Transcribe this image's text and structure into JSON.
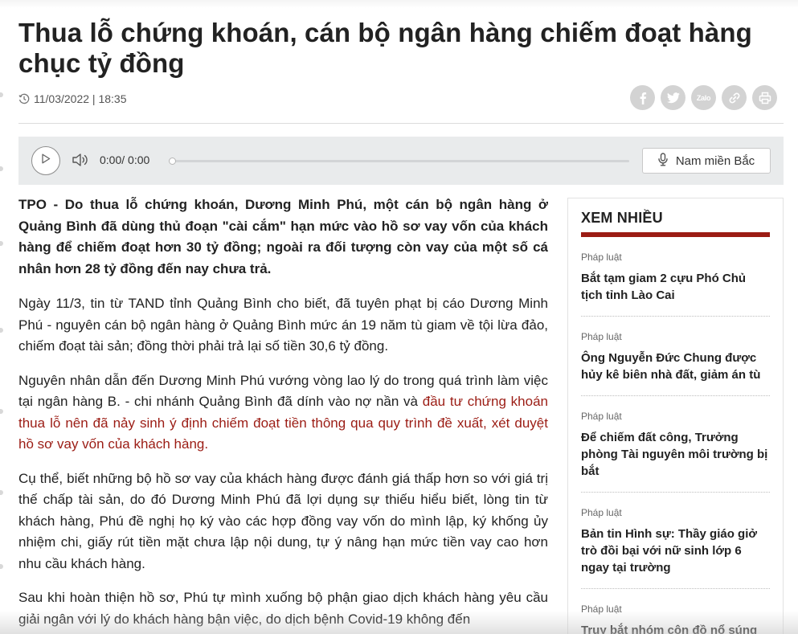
{
  "article": {
    "title": "Thua lỗ chứng khoán, cán bộ ngân hàng chiếm đoạt hàng chục tỷ đồng",
    "datetime": "11/03/2022 | 18:35",
    "sapo": "TPO - Do thua lỗ chứng khoán, Dương Minh Phú, một cán bộ ngân hàng ở Quảng Bình đã dùng thủ đoạn \"cài cắm\" hạn mức vào hồ sơ vay vốn của khách hàng để chiếm đoạt hơn 30 tỷ đồng; ngoài ra đối tượng còn vay của một số cá nhân hơn 28 tỷ đồng đến nay chưa trả.",
    "p1": "Ngày 11/3, tin từ TAND tỉnh Quảng Bình cho biết, đã tuyên phạt bị cáo Dương Minh Phú - nguyên cán bộ ngân hàng ở Quảng Bình mức án 19 năm tù giam về tội lừa đảo, chiếm đoạt tài sản; đồng thời phải trả lại số tiền 30,6 tỷ đồng.",
    "p2_text": "Nguyên nhân dẫn đến Dương Minh Phú vướng vòng lao lý do trong quá trình làm việc tại ngân hàng B. - chi nhánh Quảng Bình đã dính vào nợ nần và ",
    "p2_link": "đầu tư chứng khoán thua lỗ nên đã nảy sinh ý định chiếm đoạt tiền thông qua quy trình đề xuất, xét duyệt hồ sơ vay vốn của khách hàng.",
    "p3": "Cụ thể, biết những bộ hồ sơ vay của khách hàng được đánh giá thấp hơn so với giá trị thế chấp tài sản, do đó Dương Minh Phú đã lợi dụng sự thiếu hiểu biết, lòng tin từ khách hàng, Phú đề nghị họ ký vào các hợp đồng vay vốn do mình lập, ký khống ủy nhiệm chi, giấy rút tiền mặt chưa lập nội dung, tự ý nâng hạn mức tiền vay cao hơn nhu cầu khách hàng.",
    "p4": "Sau khi hoàn thiện hồ sơ, Phú tự mình xuống bộ phận giao dịch khách hàng yêu cầu giải ngân với lý do khách hàng bận việc, do dịch bệnh Covid-19 không đến"
  },
  "share": {
    "icons": [
      "facebook-icon",
      "twitter-icon",
      "zalo-icon",
      "link-icon",
      "print-icon"
    ],
    "zalo_label": "Zalo"
  },
  "player": {
    "time": "0:00/ 0:00",
    "voice_label": "Nam miền Bắc",
    "progress": 0
  },
  "sidebar": {
    "heading": "XEM NHIỀU",
    "items": [
      {
        "category": "Pháp luật",
        "title": "Bắt tạm giam 2 cựu Phó Chủ tịch tỉnh Lào Cai"
      },
      {
        "category": "Pháp luật",
        "title": "Ông Nguyễn Đức Chung được hủy kê biên nhà đất, giảm án tù"
      },
      {
        "category": "Pháp luật",
        "title": "Để chiếm đất công, Trưởng phòng Tài nguyên môi trường bị bắt"
      },
      {
        "category": "Pháp luật",
        "title": "Bản tin Hình sự: Thầy giáo giở trò đồi bại với nữ sinh lớp 6 ngay tại trường"
      },
      {
        "category": "Pháp luật",
        "title": "Truy bắt nhóm côn đồ nổ súng"
      }
    ]
  },
  "colors": {
    "accent": "#9b1c14",
    "player_bg": "#e9ebec",
    "share_icon_bg": "#d3d3d3",
    "text": "#222222"
  }
}
